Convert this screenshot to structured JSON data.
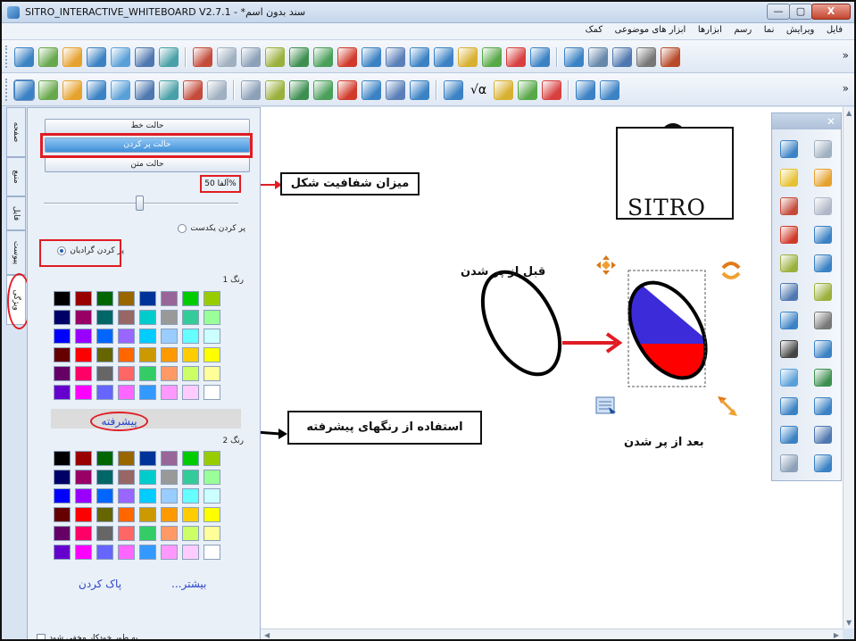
{
  "window": {
    "title": "SITRO_INTERACTIVE_WHITEBOARD V2.7.1 - *سند بدون اسم",
    "min_glyph": "—",
    "max_glyph": "▢",
    "close_glyph": "X"
  },
  "menu": [
    "فایل",
    "ویرایش",
    "نما",
    "رسم",
    "ابزارها",
    "ابزار های موضوعی",
    "کمک"
  ],
  "toolbar1": {
    "overflow": "»",
    "icons": [
      "new-page-icon",
      "open-page-icon",
      "open-folder-icon",
      "save-icon",
      "save-as-icon",
      "email-icon",
      "export-icon",
      "undo-icon",
      "redo-icon",
      "cut-icon",
      "copy-icon",
      "paste-icon",
      "paste-special-icon",
      "delete-icon",
      "screenshot-icon",
      "crop-icon",
      "zoom-in-icon",
      "zoom-out-icon",
      "bring-front-icon",
      "send-back-icon",
      "move-up-icon",
      "move-down-icon",
      "display-icon",
      "calculator-icon",
      "screen-capture-icon",
      "camera-icon",
      "marker-icon"
    ]
  },
  "toolbar2": {
    "overflow": "»",
    "math_symbol": "√α",
    "icons": [
      "select-arrow-icon",
      "pen-icon",
      "pen-light-icon",
      "highlighter-icon",
      "brush-icon",
      "marker-green-icon",
      "magic-pen-icon",
      "eraser-icon",
      "line-pen-icon",
      "triangle-ruler-icon",
      "protractor-icon",
      "compass-icon",
      "pencil-icon",
      "ruler-icon",
      "compass-draw-icon",
      "axes-icon",
      "math-icon",
      "table-icon",
      "cylinder-icon",
      "chart-icon",
      "screen-shade-icon",
      "building-blocks-icon",
      "graph-icon"
    ]
  },
  "side_tabs": [
    "صفحه",
    "منبع",
    "فایل",
    "پیوست",
    "ویژگی"
  ],
  "panel": {
    "mode_line": "حالت خط",
    "mode_fill": "حالت پر کردن",
    "mode_text": "حالت متن",
    "alpha": "آلفا 50%",
    "alpha_level": 0.5,
    "fill_solid": "پر کردن یکدست",
    "fill_gradient": "پر کردن گرادیان",
    "color1_title": "رنگ 1",
    "color2_title": "رنگ 2",
    "advanced": "پیشرفته",
    "more": "...بیشتر",
    "clear": "پاک کردن",
    "autohide": "به طور خودکار مخفی شود"
  },
  "palette1": [
    "#000000",
    "#990000",
    "#006600",
    "#996600",
    "#003399",
    "#996699",
    "#00CC00",
    "#99CC00",
    "#000066",
    "#990066",
    "#006666",
    "#996666",
    "#00CCCC",
    "#999999",
    "#33CC99",
    "#99FF99",
    "#0000FF",
    "#9900FF",
    "#0066FF",
    "#9966FF",
    "#00CCFF",
    "#99CCFF",
    "#66FFFF",
    "#CCFFFF",
    "#660000",
    "#FF0000",
    "#666600",
    "#FF6600",
    "#CC9900",
    "#FF9900",
    "#FFCC00",
    "#FFFF00",
    "#660066",
    "#FF0066",
    "#666666",
    "#FF6666",
    "#33CC66",
    "#FF9966",
    "#CCFF66",
    "#FFFF99",
    "#6600CC",
    "#FF00FF",
    "#6666FF",
    "#FF66FF",
    "#3399FF",
    "#FF99FF",
    "#FFCCFF",
    "#FFFFFF"
  ],
  "palette2": [
    "#000000",
    "#990000",
    "#006600",
    "#996600",
    "#003399",
    "#996699",
    "#00CC00",
    "#99CC00",
    "#000066",
    "#990066",
    "#006666",
    "#996666",
    "#00CCCC",
    "#999999",
    "#33CC99",
    "#99FF99",
    "#0000FF",
    "#9900FF",
    "#0066FF",
    "#9966FF",
    "#00CCFF",
    "#99CCFF",
    "#66FFFF",
    "#CCFFFF",
    "#660000",
    "#FF0000",
    "#666600",
    "#FF6600",
    "#CC9900",
    "#FF9900",
    "#FFCC00",
    "#FFFF00",
    "#660066",
    "#FF0066",
    "#666666",
    "#FF6666",
    "#33CC66",
    "#FF9966",
    "#CCFF66",
    "#FFFF99",
    "#6600CC",
    "#FF00FF",
    "#6666FF",
    "#FF66FF",
    "#3399FF",
    "#FF99FF",
    "#FFCCFF",
    "#FFFFFF"
  ],
  "callouts": {
    "alpha": "میزان شفافیت شکل",
    "advanced": "استفاده از رنگهای پیشرفته"
  },
  "canvas": {
    "before_label": "قبل از پر شدن",
    "after_label": "بعد از پر شدن",
    "logo_text": "SITRO",
    "fill_colors": [
      "#3c2bd8",
      "#ff0000",
      "#ffffff"
    ]
  },
  "right_palette": [
    "undo-icon",
    "redo-icon",
    "select-icon",
    "pen-icon",
    "highlighter-icon",
    "eraser-icon",
    "marker-icon",
    "marker-blue-icon",
    "shape-fill-icon",
    "lasso-icon",
    "rectangle-icon",
    "eraser-green-icon",
    "camera-icon",
    "video-camera-icon",
    "pen-dark-icon",
    "screen-icon",
    "keyboard-icon",
    "computer-icon",
    "shape-icon",
    "shapes-icon",
    "display-icon",
    "webcam-icon",
    "page-icon",
    "settings-icon"
  ],
  "accent": {
    "annotation_red": "#e01c24",
    "link_blue": "#2b45c6",
    "arrow_red": "#e01c24"
  }
}
